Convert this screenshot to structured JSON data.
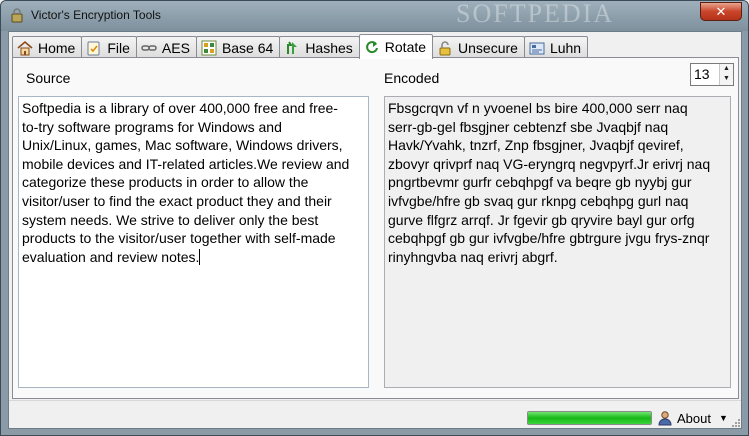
{
  "window": {
    "title": "Victor's Encryption Tools",
    "watermark": "SOFTPEDIA",
    "close_symbol": "✕"
  },
  "tabs": [
    {
      "label": "Home",
      "icon": "home-icon"
    },
    {
      "label": "File",
      "icon": "file-icon"
    },
    {
      "label": "AES",
      "icon": "chain-icon"
    },
    {
      "label": "Base 64",
      "icon": "grid-icon"
    },
    {
      "label": "Hashes",
      "icon": "arrow-up-icon"
    },
    {
      "label": "Rotate",
      "icon": "rotate-icon",
      "active": true
    },
    {
      "label": "Unsecure",
      "icon": "unlock-icon"
    },
    {
      "label": "Luhn",
      "icon": "card-icon"
    }
  ],
  "rotate": {
    "source_label": "Source",
    "encoded_label": "Encoded",
    "rotation_value": "13",
    "source_text": "Softpedia is a library of over 400,000 free and free-\nto-try software programs for Windows and\nUnix/Linux, games, Mac software, Windows drivers,\nmobile devices and IT-related articles.We review and\ncategorize these products in order to allow the\nvisitor/user to find the exact product they and their\nsystem needs. We strive to deliver only the best\nproducts to the visitor/user together with self-made\nevaluation and review notes.",
    "encoded_text": "Fbsgcrqvn vf n yvoenel bs bire 400,000 serr naq\nserr-gb-gel fbsgjner cebtenzf sbe Jvaqbjf naq\nHavk/Yvahk, tnzrf, Znp fbsgjner, Jvaqbjf qeviref,\nzbovyr qrivprf naq VG-eryngrq negvpyrf.Jr erivrj naq\npngrtbevmr gurfr cebqhpgf va beqre gb nyybj gur\nivfvgbe/hfre gb svaq gur rknpg cebqhpg gurl naq\ngurve flfgrz arrqf. Jr fgevir gb qryvire bayl gur orfg\ncebqhpgf gb gur ivfvgbe/hfre gbtrgure jvgu frys-znqr\nrinyhngvba naq erivrj abgrf."
  },
  "status": {
    "progress": 1.0,
    "about_label": "About",
    "progress_color": "#17b817"
  }
}
